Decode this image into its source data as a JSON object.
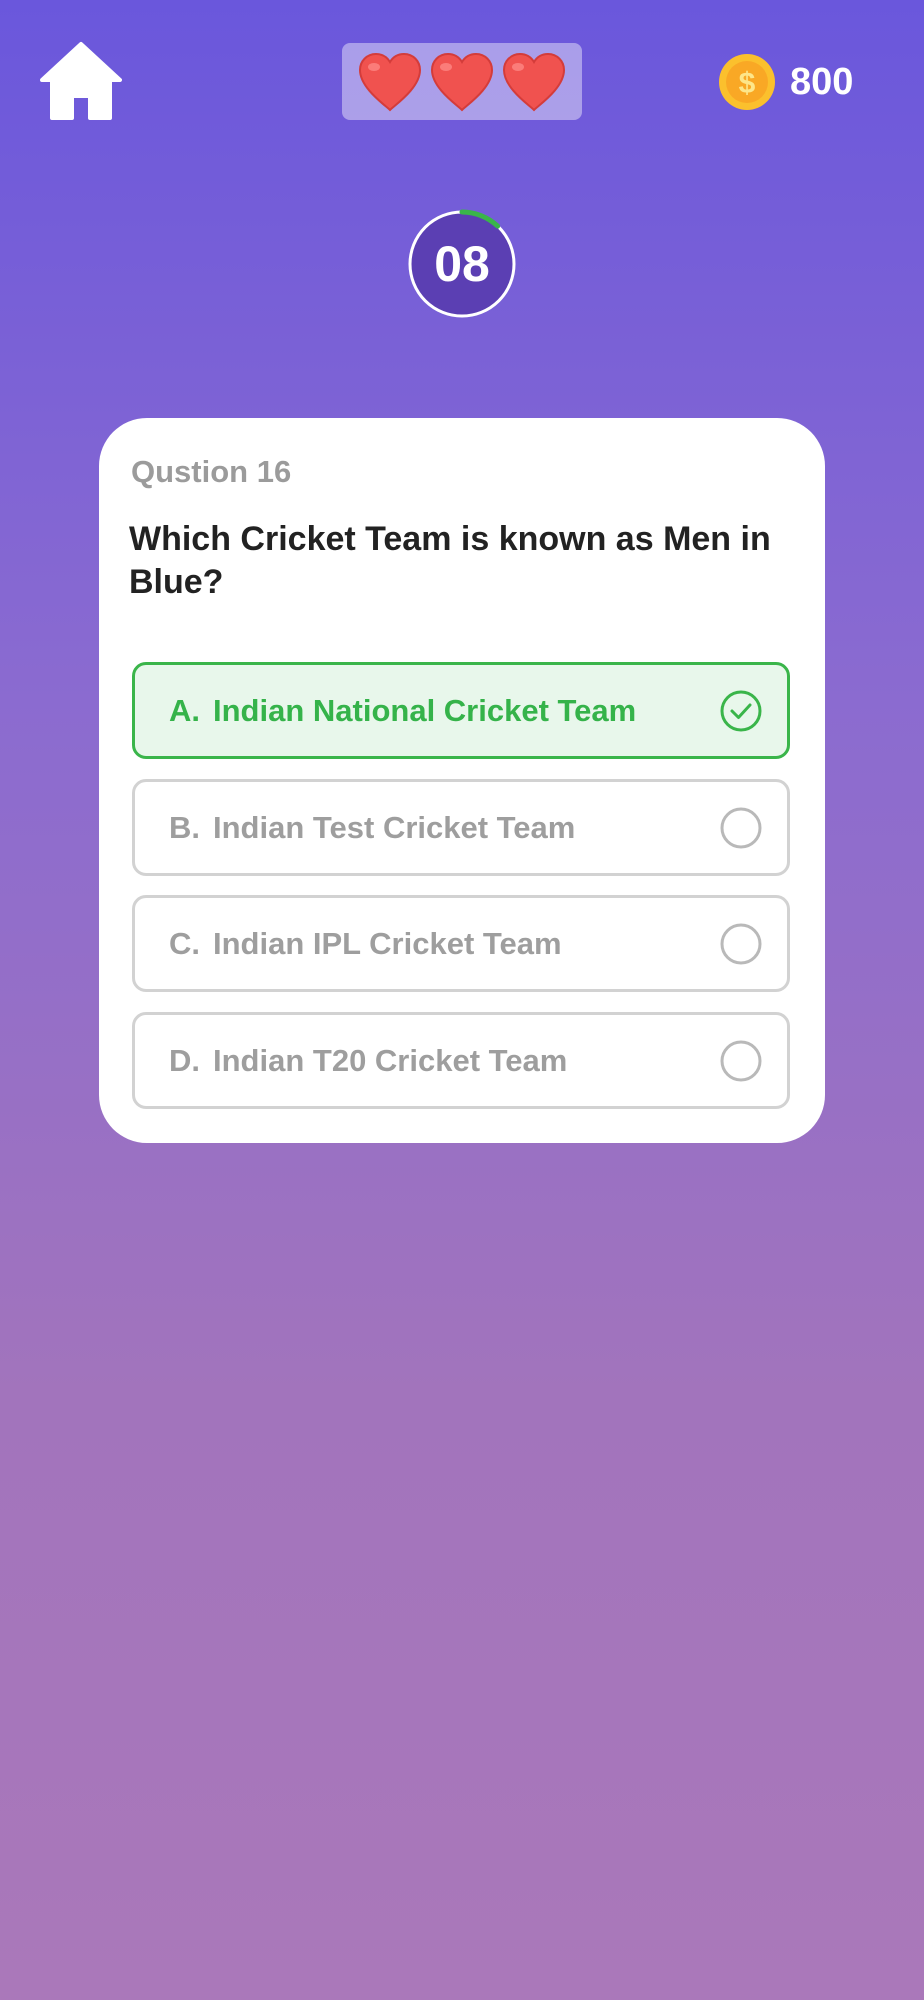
{
  "header": {
    "home_icon": "home-icon",
    "lives": [
      "heart-icon",
      "heart-icon",
      "heart-icon"
    ],
    "coins": {
      "icon": "dollar-coin-icon",
      "value": "800"
    }
  },
  "timer": {
    "value": "08",
    "remaining_fraction": 0.12
  },
  "question": {
    "number_label": "Qustion 16",
    "text": "Which Cricket Team is known as Men in Blue?"
  },
  "options": [
    {
      "letter": "A.",
      "label": "Indian National Cricket Team",
      "state": "correct"
    },
    {
      "letter": "B.",
      "label": "Indian Test Cricket Team",
      "state": "unselected"
    },
    {
      "letter": "C.",
      "label": "Indian IPL Cricket Team",
      "state": "unselected"
    },
    {
      "letter": "D.",
      "label": "Indian T20 Cricket Team",
      "state": "unselected"
    }
  ],
  "colors": {
    "correct": "#3ab54a",
    "heart": "#f0524f",
    "coin": "#fbc02d"
  }
}
